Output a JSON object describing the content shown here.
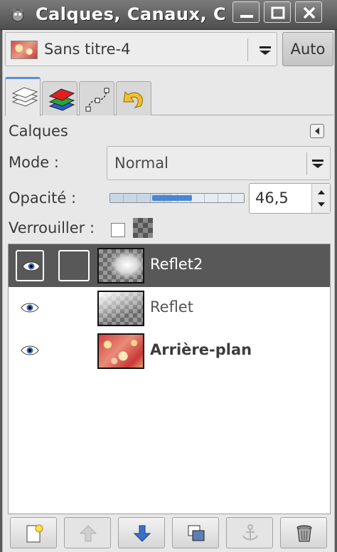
{
  "window": {
    "title": "Calques, Canaux, C",
    "buttons": [
      "minimize-icon",
      "maximize-icon",
      "close-icon"
    ]
  },
  "image_selector": {
    "name": "Sans titre-4",
    "auto_label": "Auto"
  },
  "tabs": [
    {
      "name": "layers-tab",
      "icon": "layers-icon"
    },
    {
      "name": "channels-tab",
      "icon": "channels-icon"
    },
    {
      "name": "paths-tab",
      "icon": "paths-icon"
    },
    {
      "name": "undo-history-tab",
      "icon": "undo-history-icon"
    }
  ],
  "dock": {
    "title": "Calques"
  },
  "mode": {
    "label": "Mode :",
    "value": "Normal"
  },
  "opacity": {
    "label": "Opacité :",
    "value": "46,5",
    "fraction": 0.465
  },
  "lock": {
    "label": "Verrouiller :",
    "pixels_locked": false
  },
  "layers": [
    {
      "name": "Reflet2",
      "visible": true,
      "selected": true,
      "bold": false
    },
    {
      "name": "Reflet",
      "visible": true,
      "selected": false,
      "bold": false
    },
    {
      "name": "Arrière-plan",
      "visible": true,
      "selected": false,
      "bold": true
    }
  ],
  "bottom_buttons": [
    {
      "name": "new-layer-button",
      "icon": "new-layer-icon",
      "enabled": true
    },
    {
      "name": "raise-layer-button",
      "icon": "arrow-up-icon",
      "enabled": false
    },
    {
      "name": "lower-layer-button",
      "icon": "arrow-down-icon",
      "enabled": true
    },
    {
      "name": "duplicate-layer-button",
      "icon": "duplicate-icon",
      "enabled": true
    },
    {
      "name": "anchor-layer-button",
      "icon": "anchor-icon",
      "enabled": false
    },
    {
      "name": "delete-layer-button",
      "icon": "trash-icon",
      "enabled": true
    }
  ],
  "colors": {
    "selection": "#585858",
    "accent": "#4a86d6"
  }
}
